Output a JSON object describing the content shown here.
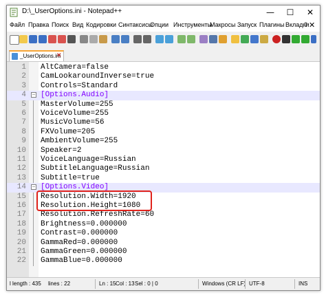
{
  "window": {
    "title": "D:\\_UserOptions.ini - Notepad++",
    "minimize": "—",
    "maximize": "☐",
    "close": "✕"
  },
  "menu": [
    "Файл",
    "Правка",
    "Поиск",
    "Вид",
    "Кодировки",
    "Синтаксисы",
    "Опции",
    "Инструменты",
    "Макросы",
    "Запуск",
    "Плагины",
    "Вкладки",
    "?"
  ],
  "menu_close": "✕",
  "tab": {
    "label": "_UserOptions.ini",
    "close": "✕"
  },
  "lines": [
    {
      "n": "1",
      "key": "AltCamera",
      "val": "false"
    },
    {
      "n": "2",
      "key": "CamLookaroundInverse",
      "val": "true"
    },
    {
      "n": "3",
      "key": "Controls",
      "val": "Standard"
    },
    {
      "n": "4",
      "section": "[Options.Audio]"
    },
    {
      "n": "5",
      "key": "MasterVolume",
      "val": "255"
    },
    {
      "n": "6",
      "key": "VoiceVolume",
      "val": "255"
    },
    {
      "n": "7",
      "key": "MusicVolume",
      "val": "56"
    },
    {
      "n": "8",
      "key": "FXVolume",
      "val": "205"
    },
    {
      "n": "9",
      "key": "AmbientVolume",
      "val": "255"
    },
    {
      "n": "10",
      "key": "Speaker",
      "val": "2"
    },
    {
      "n": "11",
      "key": "VoiceLanguage",
      "val": "Russian"
    },
    {
      "n": "12",
      "key": "SubtitleLanguage",
      "val": "Russian"
    },
    {
      "n": "13",
      "key": "Subtitle",
      "val": "true"
    },
    {
      "n": "14",
      "section": "[Options.Video]"
    },
    {
      "n": "15",
      "key": "Resolution.Width",
      "val": "1920"
    },
    {
      "n": "16",
      "key": "Resolution.Height",
      "val": "1080"
    },
    {
      "n": "17",
      "key": "Resolution.RefreshRate",
      "val": "60"
    },
    {
      "n": "18",
      "key": "Brightness",
      "val": "0.000000"
    },
    {
      "n": "19",
      "key": "Contrast",
      "val": "0.000000"
    },
    {
      "n": "20",
      "key": "GammaRed",
      "val": "0.000000"
    },
    {
      "n": "21",
      "key": "GammaGreen",
      "val": "0.000000"
    },
    {
      "n": "22",
      "key": "GammaBlue",
      "val": "0.000000"
    }
  ],
  "status": {
    "length": "l length : 435",
    "lines": "lines : 22",
    "ln": "Ln : 15",
    "col": "Col : 13",
    "sel": "Sel : 0 | 0",
    "eol": "Windows (CR LF)",
    "encoding": "UTF-8",
    "mode": "INS"
  }
}
